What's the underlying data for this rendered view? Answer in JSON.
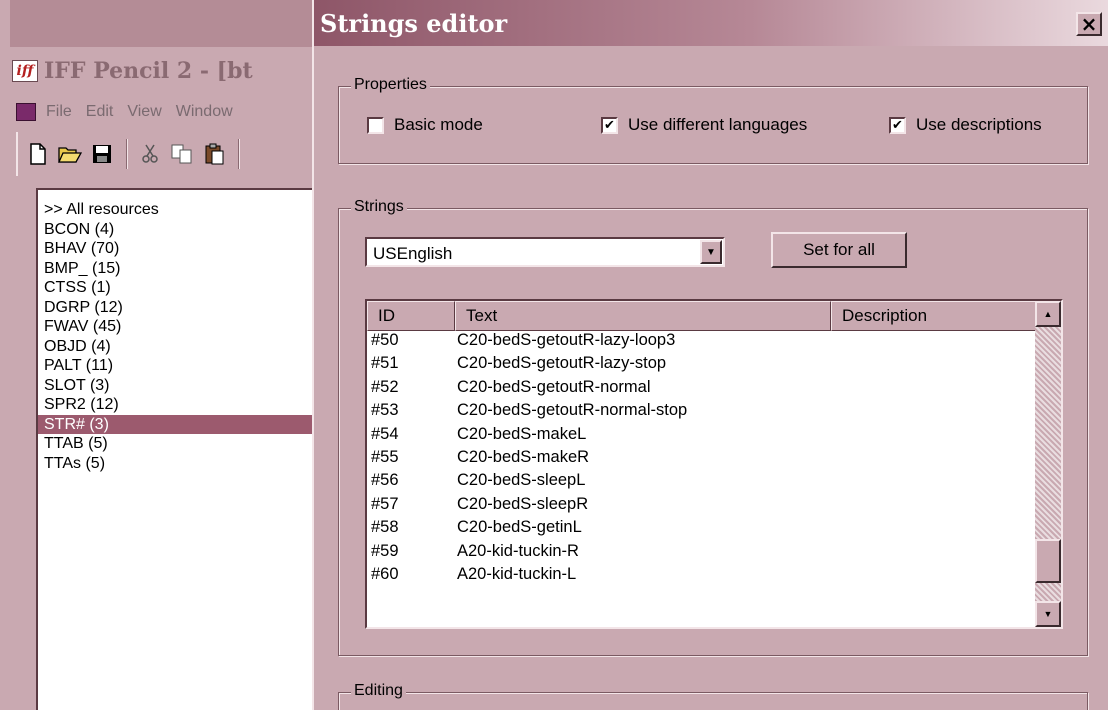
{
  "main_window": {
    "logo_text": "iff",
    "title": "IFF Pencil 2 - [bt",
    "menu": [
      "File",
      "Edit",
      "View",
      "Window"
    ],
    "toolbar_icons": [
      "new-icon",
      "open-icon",
      "save-icon",
      "cut-icon",
      "copy-icon",
      "paste-icon"
    ],
    "resources": [
      {
        "label": ">> All resources",
        "selected": false
      },
      {
        "label": "BCON (4)",
        "selected": false
      },
      {
        "label": "BHAV (70)",
        "selected": false
      },
      {
        "label": "BMP_ (15)",
        "selected": false
      },
      {
        "label": "CTSS (1)",
        "selected": false
      },
      {
        "label": "DGRP (12)",
        "selected": false
      },
      {
        "label": "FWAV (45)",
        "selected": false
      },
      {
        "label": "OBJD (4)",
        "selected": false
      },
      {
        "label": "PALT (11)",
        "selected": false
      },
      {
        "label": "SLOT (3)",
        "selected": false
      },
      {
        "label": "SPR2 (12)",
        "selected": false
      },
      {
        "label": "STR# (3)",
        "selected": true
      },
      {
        "label": "TTAB (5)",
        "selected": false
      },
      {
        "label": "TTAs (5)",
        "selected": false
      }
    ]
  },
  "dialog": {
    "title": "Strings editor",
    "close_label": "×",
    "properties": {
      "label": "Properties",
      "basic_mode": {
        "label": "Basic mode",
        "checked": false
      },
      "use_languages": {
        "label": "Use different languages",
        "checked": true
      },
      "use_descriptions": {
        "label": "Use descriptions",
        "checked": true
      }
    },
    "strings": {
      "label": "Strings",
      "language": "USEnglish",
      "set_for_all_label": "Set for all",
      "columns": [
        "ID",
        "Text",
        "Description"
      ],
      "rows": [
        {
          "id": "#50",
          "text": "C20-bedS-getoutR-lazy-loop3",
          "description": ""
        },
        {
          "id": "#51",
          "text": "C20-bedS-getoutR-lazy-stop",
          "description": ""
        },
        {
          "id": "#52",
          "text": "C20-bedS-getoutR-normal",
          "description": ""
        },
        {
          "id": "#53",
          "text": "C20-bedS-getoutR-normal-stop",
          "description": ""
        },
        {
          "id": "#54",
          "text": "C20-bedS-makeL",
          "description": ""
        },
        {
          "id": "#55",
          "text": "C20-bedS-makeR",
          "description": ""
        },
        {
          "id": "#56",
          "text": "C20-bedS-sleepL",
          "description": ""
        },
        {
          "id": "#57",
          "text": "C20-bedS-sleepR",
          "description": ""
        },
        {
          "id": "#58",
          "text": "C20-bedS-getinL",
          "description": ""
        },
        {
          "id": "#59",
          "text": "A20-kid-tuckin-R",
          "description": ""
        },
        {
          "id": "#60",
          "text": "A20-kid-tuckin-L",
          "description": ""
        }
      ],
      "scroll_position": 0.92
    },
    "editing": {
      "label": "Editing"
    }
  }
}
